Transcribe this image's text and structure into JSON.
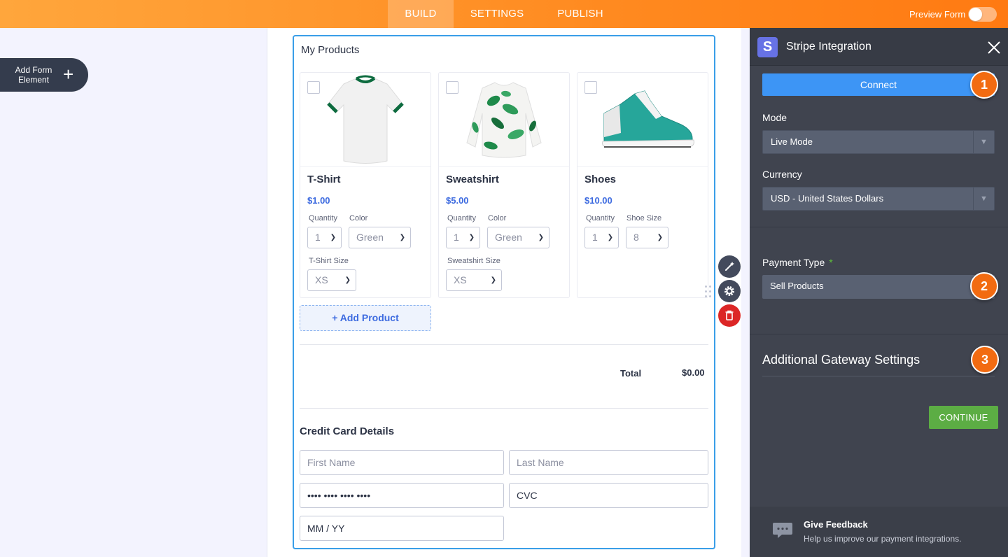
{
  "topbar": {
    "tabs": [
      {
        "label": "BUILD",
        "active": true
      },
      {
        "label": "SETTINGS",
        "active": false
      },
      {
        "label": "PUBLISH",
        "active": false
      }
    ],
    "preview_label": "Preview Form",
    "preview_enabled": false
  },
  "sidebar": {
    "add_element_label": "Add Form Element",
    "add_icon": "plus-icon"
  },
  "form": {
    "products_title": "My Products",
    "products": [
      {
        "name": "T-Shirt",
        "price": "$1.00",
        "options": [
          {
            "label": "Quantity",
            "value": "1"
          },
          {
            "label": "Color",
            "value": "Green"
          },
          {
            "label": "T-Shirt Size",
            "value": "XS"
          }
        ]
      },
      {
        "name": "Sweatshirt",
        "price": "$5.00",
        "options": [
          {
            "label": "Quantity",
            "value": "1"
          },
          {
            "label": "Color",
            "value": "Green"
          },
          {
            "label": "Sweatshirt Size",
            "value": "XS"
          }
        ]
      },
      {
        "name": "Shoes",
        "price": "$10.00",
        "options": [
          {
            "label": "Quantity",
            "value": "1"
          },
          {
            "label": "Shoe Size",
            "value": "8"
          }
        ]
      }
    ],
    "add_product_label": "+ Add Product",
    "total_label": "Total",
    "total_value": "$0.00",
    "cc_title": "Credit Card Details",
    "cc_fields": {
      "first_name": "First Name",
      "last_name": "Last Name",
      "card_number": "•••• •••• •••• ••••",
      "cvc": "CVC",
      "expiry": "MM / YY"
    }
  },
  "tools": {
    "wand_icon": "magic-wand-icon",
    "settings_icon": "gear-icon",
    "delete_icon": "trash-icon"
  },
  "panel": {
    "logo_letter": "S",
    "title": "Stripe Integration",
    "close_icon": "close-icon",
    "connect_label": "Connect",
    "mode_label": "Mode",
    "mode_value": "Live Mode",
    "currency_label": "Currency",
    "currency_value": "USD - United States Dollars",
    "payment_type_label": "Payment Type",
    "payment_type_required": "*",
    "payment_type_value": "Sell Products",
    "additional_title": "Additional Gateway Settings",
    "continue_label": "CONTINUE",
    "feedback_title": "Give Feedback",
    "feedback_sub": "Help us improve our payment integrations.",
    "badges": [
      "1",
      "2",
      "3"
    ]
  },
  "colors": {
    "accent_orange": "#ff8a20",
    "connect_blue": "#3d95f5",
    "continue_green": "#5cad44",
    "price_blue": "#3d6be0",
    "badge_orange": "#f26b11"
  }
}
